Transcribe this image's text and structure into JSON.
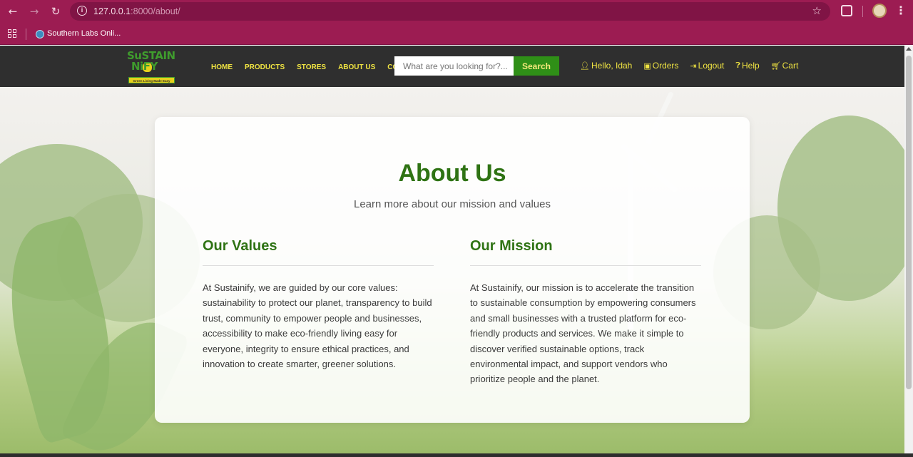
{
  "browser": {
    "url_host": "127.0.0.1",
    "url_rest": ":8000/about/",
    "bookmark_label": "Southern Labs Onli..."
  },
  "site": {
    "logo": {
      "line1": "SuSTAIN",
      "line2": "NiFY",
      "tagline": "Green Living Made Easy"
    },
    "nav": [
      "HOME",
      "PRODUCTS",
      "STORES",
      "ABOUT US",
      "CONTACT"
    ],
    "search": {
      "placeholder": "What are you looking for?...",
      "button": "Search"
    },
    "user_links": {
      "greeting": "Hello, Idah",
      "orders": "Orders",
      "logout": "Logout",
      "help": "Help",
      "cart": "Cart"
    },
    "colors": {
      "header_bg": "#2f2f2f",
      "nav_text": "#f0e442",
      "accent_green": "#2f7314",
      "search_button": "#2f8f17"
    }
  },
  "about": {
    "title": "About Us",
    "subtitle": "Learn more about our mission and values",
    "values": {
      "heading": "Our Values",
      "body": "At Sustainify, we are guided by our core values: sustainability to protect our planet, transparency to build trust, community to empower people and businesses, accessibility to make eco-friendly living easy for everyone, integrity to ensure ethical practices, and innovation to create smarter, greener solutions."
    },
    "mission": {
      "heading": "Our Mission",
      "body": "At Sustainify, our mission is to accelerate the transition to sustainable consumption by empowering consumers and small businesses with a trusted platform for eco-friendly products and services. We make it simple to discover verified sustainable options, track environmental impact, and support vendors who prioritize people and the planet."
    }
  }
}
